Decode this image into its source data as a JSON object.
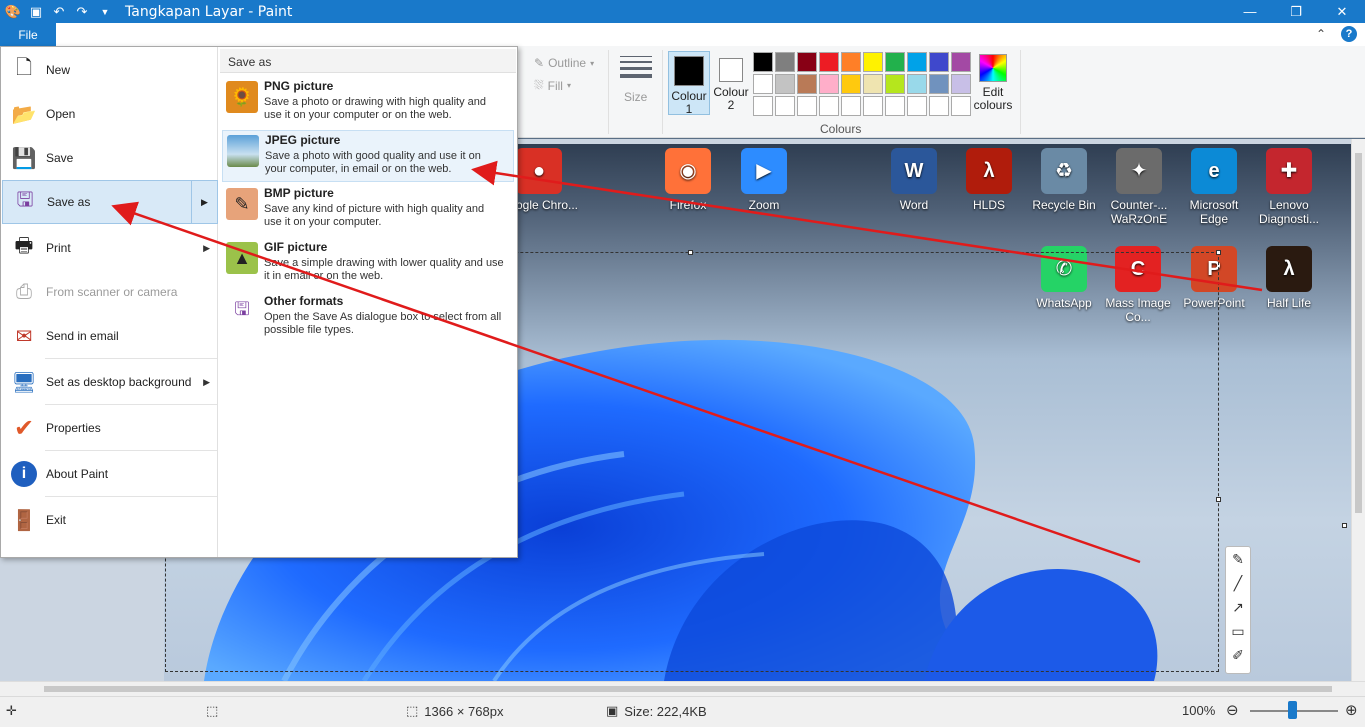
{
  "titlebar": {
    "title": "Tangkapan Layar - Paint"
  },
  "tabs": {
    "file": "File"
  },
  "ribbon": {
    "outline": "Outline",
    "fill": "Fill",
    "size": "Size",
    "colour1": "Colour 1",
    "colour2": "Colour 2",
    "edit_colours": "Edit colours",
    "colours_group": "Colours",
    "palette": [
      "#000000",
      "#7f7f7f",
      "#880015",
      "#ed1c24",
      "#ff7f27",
      "#fff200",
      "#22b14c",
      "#00a2e8",
      "#3f48cc",
      "#a349a4",
      "#ffffff",
      "#c3c3c3",
      "#b97a57",
      "#ffaec9",
      "#ffc90e",
      "#efe4b0",
      "#b5e61d",
      "#99d9ea",
      "#7092be",
      "#c8bfe7",
      "#ffffff",
      "#ffffff",
      "#ffffff",
      "#ffffff",
      "#ffffff",
      "#ffffff",
      "#ffffff",
      "#ffffff",
      "#ffffff",
      "#ffffff"
    ]
  },
  "file_menu": {
    "items": [
      {
        "label": "New"
      },
      {
        "label": "Open"
      },
      {
        "label": "Save"
      },
      {
        "label": "Save as"
      },
      {
        "label": "Print"
      },
      {
        "label": "From scanner or camera"
      },
      {
        "label": "Send in email"
      },
      {
        "label": "Set as desktop background"
      },
      {
        "label": "Properties"
      },
      {
        "label": "About Paint"
      },
      {
        "label": "Exit"
      }
    ]
  },
  "save_as": {
    "header": "Save as",
    "options": [
      {
        "title": "PNG picture",
        "desc": "Save a photo or drawing with high quality and use it on your computer or on the web."
      },
      {
        "title": "JPEG picture",
        "desc": "Save a photo with good quality and use it on your computer, in email or on the web."
      },
      {
        "title": "BMP picture",
        "desc": "Save any kind of picture with high quality and use it on your computer."
      },
      {
        "title": "GIF picture",
        "desc": "Save a simple drawing with lower quality and use it in email or on the web."
      },
      {
        "title": "Other formats",
        "desc": "Open the Save As dialogue box to select from all possible file types."
      }
    ]
  },
  "desktop_icons": [
    {
      "label": "Google Chro...",
      "color": "#d93025",
      "glyph": "●"
    },
    {
      "label": "Firefox",
      "color": "#ff7139",
      "glyph": "◉"
    },
    {
      "label": "Zoom",
      "color": "#2d8cff",
      "glyph": "▶"
    },
    {
      "label": "Word",
      "color": "#2b579a",
      "glyph": "W"
    },
    {
      "label": "HLDS",
      "color": "#b01c0c",
      "glyph": "λ"
    },
    {
      "label": "Recycle Bin",
      "color": "#6a8aa5",
      "glyph": "♻"
    },
    {
      "label": "Counter-... WaRzOnE",
      "color": "#6b6b6b",
      "glyph": "✦"
    },
    {
      "label": "Microsoft Edge",
      "color": "#0c8ad6",
      "glyph": "e"
    },
    {
      "label": "Lenovo Diagnosti...",
      "color": "#c4262e",
      "glyph": "✚"
    },
    {
      "label": "WhatsApp",
      "color": "#25d366",
      "glyph": "✆"
    },
    {
      "label": "Mass Image Co...",
      "color": "#e32222",
      "glyph": "C"
    },
    {
      "label": "PowerPoint",
      "color": "#d24726",
      "glyph": "P"
    },
    {
      "label": "Half Life",
      "color": "#2a1a10",
      "glyph": "λ"
    }
  ],
  "statusbar": {
    "dimensions": "1366 × 768px",
    "size": "Size: 222,4KB",
    "zoom": "100%"
  }
}
